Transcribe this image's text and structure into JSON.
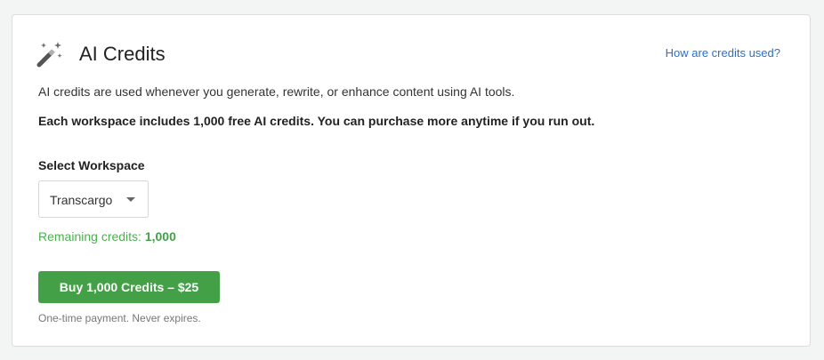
{
  "header": {
    "icon": "magic-wand-icon",
    "title": "AI Credits",
    "help_link": "How are credits used?"
  },
  "description": "AI credits are used whenever you generate, rewrite, or enhance content using AI tools.",
  "description_bold": "Each workspace includes 1,000 free AI credits. You can purchase more anytime if you run out.",
  "workspace_select": {
    "label": "Select Workspace",
    "value": "Transcargo",
    "icon": "chevron-down-icon"
  },
  "remaining": {
    "label": "Remaining credits: ",
    "value": "1,000"
  },
  "buy_button": {
    "label": "Buy 1,000 Credits – $25"
  },
  "note": "One-time payment. Never expires.",
  "colors": {
    "accent_green": "#43a047",
    "link_blue": "#2a6fc9"
  }
}
